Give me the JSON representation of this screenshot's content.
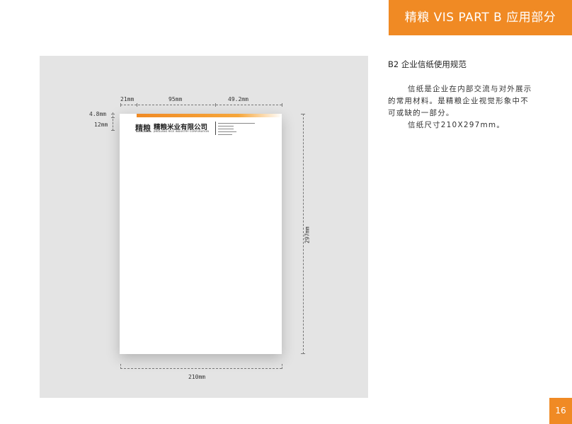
{
  "header": {
    "title": "精粮 VIS PART B 应用部分"
  },
  "section": {
    "title": "B2 企业信纸使用规范"
  },
  "body": {
    "para1_line1": "信纸是企业在内部交流与对外展示",
    "para1_line2": "的常用材料。是精粮企业视觉形象中不",
    "para1_line3": "可或缺的一部分。",
    "para2": "信纸尺寸210X297mm。"
  },
  "dimensions": {
    "left_margin": "21mm",
    "header_width": "95mm",
    "right_block": "49.2mm",
    "top_margin": "4.8mm",
    "header_height": "12mm",
    "paper_height": "297mm",
    "paper_width": "210mm"
  },
  "letterhead": {
    "logo_text": "精粮",
    "company_cn": "精粮米业有限公司",
    "company_en": "JINGLIANG RICE INDUSTRY CORPORATION"
  },
  "colors": {
    "accent": "#f08a24",
    "stage": "#e4e4e4"
  },
  "page": {
    "number": "16"
  }
}
